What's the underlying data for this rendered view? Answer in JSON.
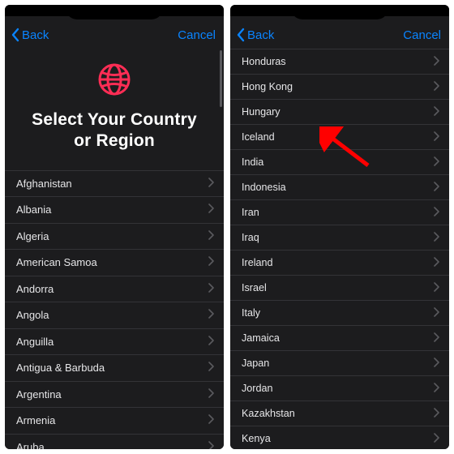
{
  "colors": {
    "accent": "#0a84ff",
    "highlight": "#ff2d55"
  },
  "nav": {
    "back": "Back",
    "cancel": "Cancel"
  },
  "hero": {
    "title_line1": "Select Your Country",
    "title_line2": "or Region"
  },
  "left_countries": [
    "Afghanistan",
    "Albania",
    "Algeria",
    "American Samoa",
    "Andorra",
    "Angola",
    "Anguilla",
    "Antigua & Barbuda",
    "Argentina",
    "Armenia",
    "Aruba"
  ],
  "right_countries": [
    "Honduras",
    "Hong Kong",
    "Hungary",
    "Iceland",
    "India",
    "Indonesia",
    "Iran",
    "Iraq",
    "Ireland",
    "Israel",
    "Italy",
    "Jamaica",
    "Japan",
    "Jordan",
    "Kazakhstan",
    "Kenya"
  ],
  "arrow_target": "India"
}
